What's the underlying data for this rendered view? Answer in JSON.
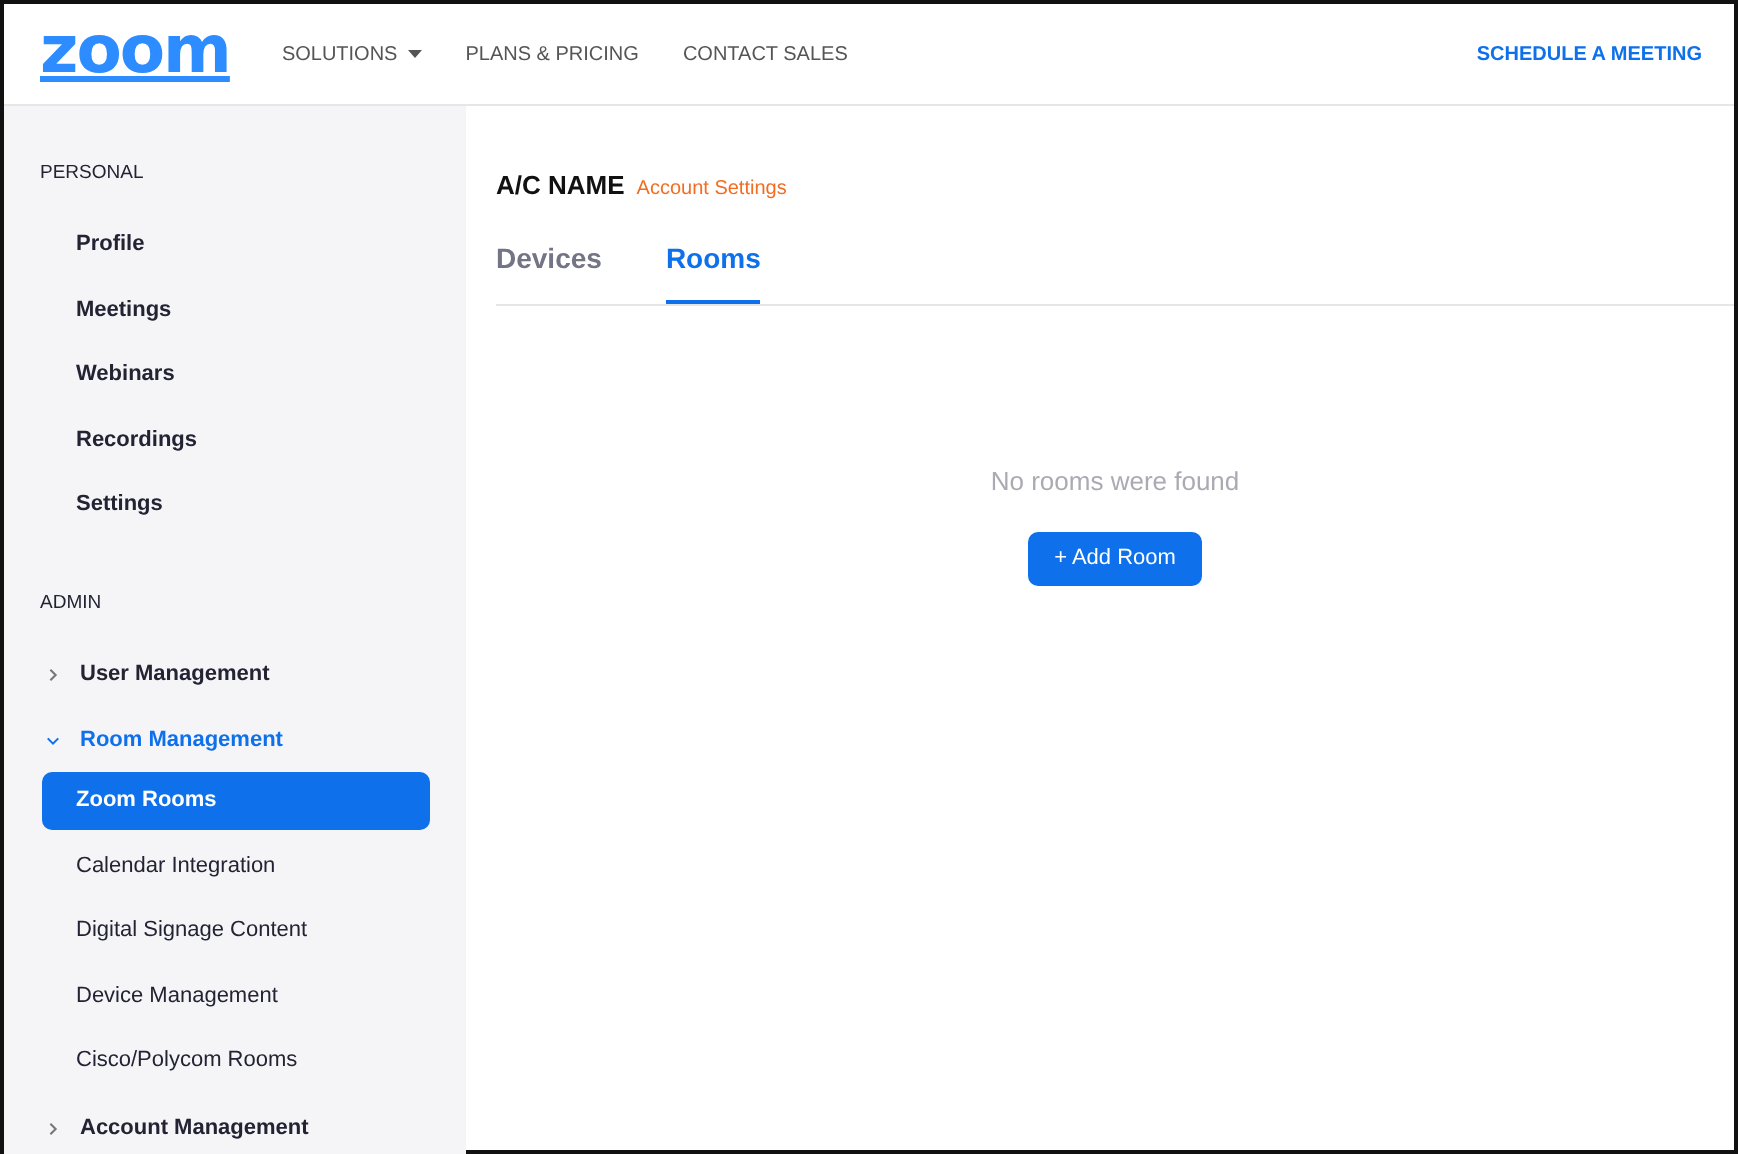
{
  "header": {
    "logo": "zoom",
    "nav": [
      {
        "label": "SOLUTIONS",
        "dropdown": true
      },
      {
        "label": "PLANS & PRICING",
        "dropdown": false
      },
      {
        "label": "CONTACT SALES",
        "dropdown": false
      }
    ],
    "action": "SCHEDULE A MEETING"
  },
  "sidebar": {
    "sections": [
      {
        "title": "PERSONAL",
        "items": [
          {
            "kind": "link",
            "label": "Profile",
            "selected": false
          },
          {
            "kind": "link",
            "label": "Meetings",
            "selected": false
          },
          {
            "kind": "link",
            "label": "Webinars",
            "selected": false
          },
          {
            "kind": "link",
            "label": "Recordings",
            "selected": false
          },
          {
            "kind": "link",
            "label": "Settings",
            "selected": false
          }
        ]
      },
      {
        "title": "ADMIN",
        "items": [
          {
            "kind": "group",
            "label": "User Management",
            "expanded": false
          },
          {
            "kind": "group",
            "label": "Room Management",
            "expanded": true,
            "children": [
              {
                "label": "Zoom Rooms",
                "selected": true
              },
              {
                "label": "Calendar Integration",
                "selected": false
              },
              {
                "label": "Digital Signage Content",
                "selected": false
              },
              {
                "label": "Device Management",
                "selected": false
              },
              {
                "label": "Cisco/Polycom Rooms",
                "selected": false
              }
            ]
          },
          {
            "kind": "group",
            "label": "Account Management",
            "expanded": false
          }
        ]
      }
    ]
  },
  "main": {
    "account_name": "A/C NAME",
    "account_link": "Account Settings",
    "tabs": [
      {
        "label": "Devices",
        "selected": false
      },
      {
        "label": "Rooms",
        "selected": true
      }
    ],
    "empty_message": "No rooms were found",
    "add_button": "+ Add Room"
  }
}
